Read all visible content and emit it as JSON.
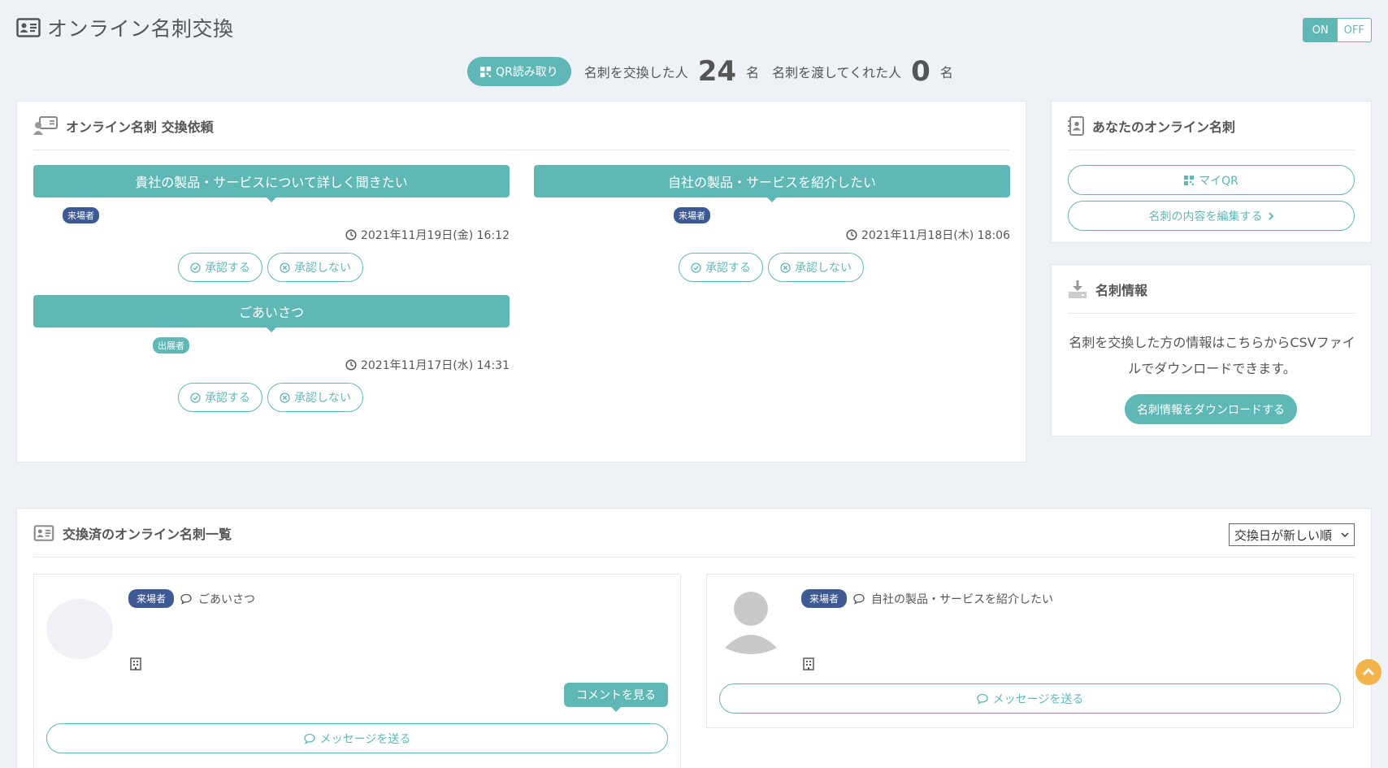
{
  "header": {
    "title": "オンライン名刺交換",
    "toggle_on": "ON",
    "toggle_off": "OFF"
  },
  "stats": {
    "qr_button": "QR読み取り",
    "exchanged_label": "名刺を交換した人",
    "exchanged_count": "24",
    "exchanged_unit": "名",
    "received_label": "名刺を渡してくれた人",
    "received_count": "0",
    "received_unit": "名"
  },
  "requests": {
    "title": "オンライン名刺 交換依頼",
    "items": [
      {
        "message": "貴社の製品・サービスについて詳しく聞きたい",
        "badge": "来場者",
        "date": "2021年11月19日(金) 16:12",
        "approve": "承認する",
        "reject": "承認しない"
      },
      {
        "message": "自社の製品・サービスを紹介したい",
        "badge": "来場者",
        "date": "2021年11月18日(木) 18:06",
        "approve": "承認する",
        "reject": "承認しない"
      },
      {
        "message": "ごあいさつ",
        "badge": "出展者",
        "date": "2021年11月17日(水) 14:31",
        "approve": "承認する",
        "reject": "承認しない"
      }
    ]
  },
  "my_card": {
    "title": "あなたのオンライン名刺",
    "my_qr": "マイQR",
    "edit": "名刺の内容を編集する"
  },
  "card_info": {
    "title": "名刺情報",
    "description": "名刺を交換した方の情報はこちらからCSVファイルでダウンロードできます。",
    "download": "名刺情報をダウンロードする"
  },
  "exchanged": {
    "title": "交換済のオンライン名刺一覧",
    "sort": "交換日が新しい順",
    "cards": [
      {
        "badge": "来場者",
        "message": "ごあいさつ",
        "comment_button": "コメントを見る",
        "send_message": "メッセージを送る"
      },
      {
        "badge": "来場者",
        "message": "自社の製品・サービスを紹介したい",
        "send_message": "メッセージを送る"
      }
    ]
  },
  "colors": {
    "teal": "#5fb8b6",
    "navy_badge": "#3e5a95",
    "scroll_top": "#f2b44a",
    "background": "#eef1f6"
  }
}
